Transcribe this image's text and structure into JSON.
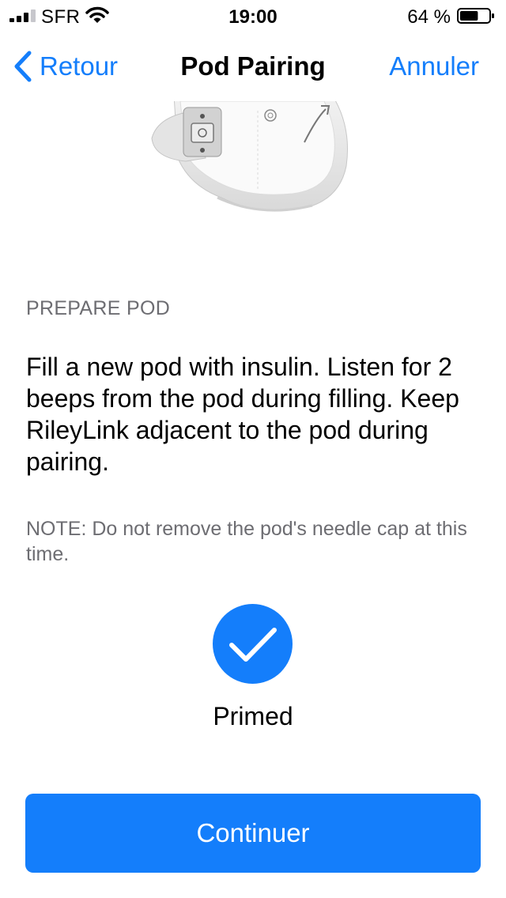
{
  "status_bar": {
    "carrier": "SFR",
    "time": "19:00",
    "battery_percent": "64 %",
    "battery_level": 0.64
  },
  "nav": {
    "back_label": "Retour",
    "title": "Pod Pairing",
    "cancel_label": "Annuler"
  },
  "content": {
    "section_header": "PREPARE POD",
    "instructions": "Fill a new pod with insulin. Listen for 2 beeps from the pod during filling. Keep RileyLink adjacent to the pod during pairing.",
    "note": "NOTE: Do not remove the pod's needle cap at this time."
  },
  "status": {
    "label": "Primed",
    "icon": "checkmark-icon"
  },
  "actions": {
    "continue_label": "Continuer"
  },
  "colors": {
    "accent": "#147efb",
    "secondary_text": "#6d6d72"
  }
}
